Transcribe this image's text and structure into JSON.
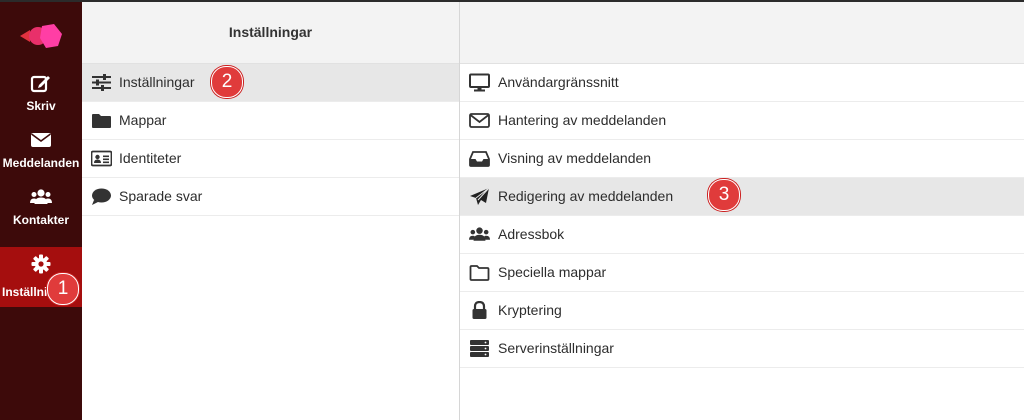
{
  "nav": {
    "items": [
      {
        "label": "Skriv",
        "icon": "compose-icon"
      },
      {
        "label": "Meddelanden",
        "icon": "envelope-icon"
      },
      {
        "label": "Kontakter",
        "icon": "users-icon"
      },
      {
        "label": "Inställningar",
        "icon": "gear-icon",
        "active": true
      }
    ]
  },
  "settings_column": {
    "header": "Inställningar",
    "items": [
      {
        "label": "Inställningar",
        "icon": "sliders-icon",
        "selected": true
      },
      {
        "label": "Mappar",
        "icon": "folder-icon"
      },
      {
        "label": "Identiteter",
        "icon": "id-card-icon"
      },
      {
        "label": "Sparade svar",
        "icon": "speech-bubble-icon"
      }
    ]
  },
  "sections_column": {
    "header": "",
    "items": [
      {
        "label": "Användargränssnitt",
        "icon": "monitor-icon"
      },
      {
        "label": "Hantering av meddelanden",
        "icon": "envelope-outline-icon"
      },
      {
        "label": "Visning av meddelanden",
        "icon": "inbox-tray-icon"
      },
      {
        "label": "Redigering av meddelanden",
        "icon": "paper-plane-icon",
        "selected": true
      },
      {
        "label": "Adressbok",
        "icon": "users-icon"
      },
      {
        "label": "Speciella mappar",
        "icon": "folder-outline-icon"
      },
      {
        "label": "Kryptering",
        "icon": "lock-icon"
      },
      {
        "label": "Serverinställningar",
        "icon": "server-icon"
      }
    ]
  },
  "callouts": [
    "1",
    "2",
    "3"
  ],
  "colors": {
    "nav_bg": "#3d0a0a",
    "nav_active": "#a50e0e",
    "badge": "#e03b3b",
    "selected_row": "#e7e7e7"
  }
}
